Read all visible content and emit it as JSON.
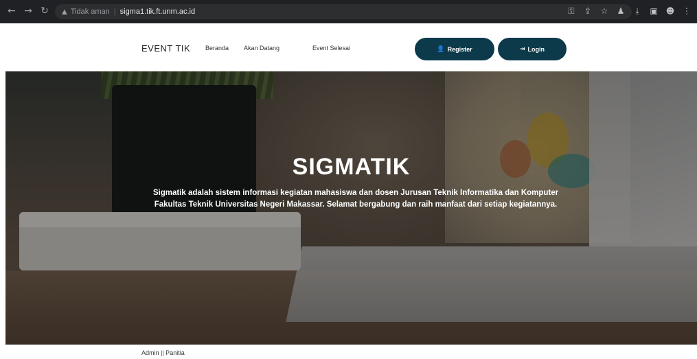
{
  "browser": {
    "security_label": "Tidak aman",
    "url": "sigma1.tik.ft.unm.ac.id"
  },
  "navbar": {
    "brand": "EVENT TIK",
    "links": [
      "Beranda",
      "Akan Datang",
      "Event Selesai"
    ],
    "register_label": "Register",
    "login_label": "Login"
  },
  "hero": {
    "title": "SIGMATIK",
    "description": "Sigmatik adalah sistem informasi kegiatan mahasiswa dan dosen Jurusan Teknik Informatika dan Komputer Fakultas Teknik Universitas Negeri Makassar. Selamat bergabung dan raih manfaat dari setiap kegiatannya."
  },
  "footer": {
    "links_text": "Admin || Panitia"
  },
  "colors": {
    "button_bg": "#0c3a4a",
    "chrome_bg": "#202124"
  },
  "icons": {
    "register": "user-plus-icon",
    "login": "sign-in-icon"
  }
}
